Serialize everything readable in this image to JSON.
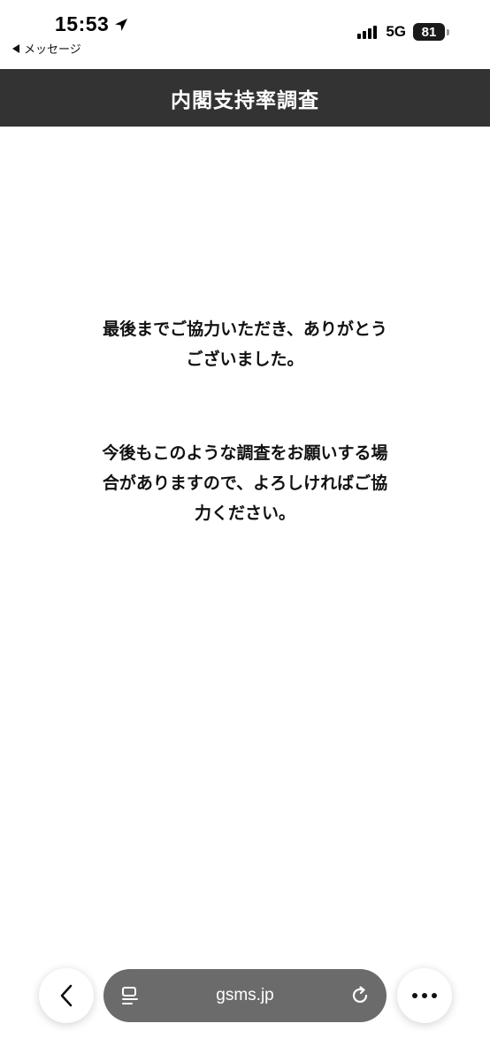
{
  "status_bar": {
    "time": "15:53",
    "back_app_label": "メッセージ",
    "network": "5G",
    "battery_level": "81",
    "icons": [
      "location-arrow-icon",
      "cellular-signal-icon",
      "battery-icon"
    ]
  },
  "header": {
    "title": "内閣支持率調査"
  },
  "content": {
    "thanks_message": "最後までご協力いただき、ありがとうございました。",
    "future_message": "今後もこのような調査をお願いする場合がありますので、よろしければご協力ください。"
  },
  "toolbar": {
    "url": "gsms.jp",
    "icons": [
      "back-chevron-icon",
      "page-menu-icon",
      "reload-icon",
      "more-icon"
    ]
  }
}
